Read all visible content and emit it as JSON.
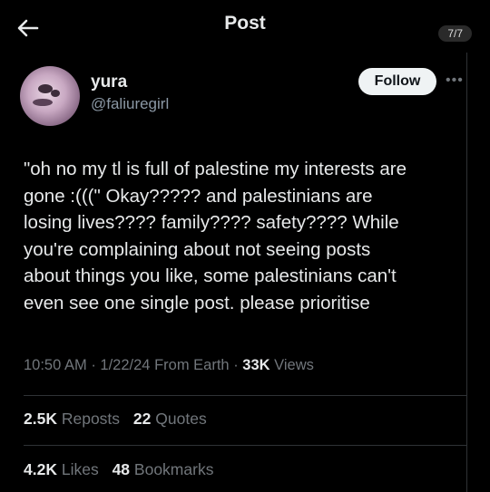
{
  "header": {
    "title": "Post",
    "pager": "7/7"
  },
  "author": {
    "name": "yura",
    "handle": "@faliuregirl",
    "follow_label": "Follow"
  },
  "tweet": {
    "lines": [
      "\"oh no my tl is full of palestine my interests are",
      "gone :(((\" Okay????? and palestinians are",
      "losing lives???? family???? safety???? While",
      "you're complaining about not seeing posts",
      "about things you like, some palestinians can't",
      "even see one single post. please prioritise"
    ]
  },
  "meta": {
    "time": "10:50 AM",
    "date": "1/22/24",
    "location": "From Earth",
    "views_count": "33K",
    "views_label": "Views"
  },
  "stats": {
    "reposts_count": "2.5K",
    "reposts_label": "Reposts",
    "quotes_count": "22",
    "quotes_label": "Quotes",
    "likes_count": "4.2K",
    "likes_label": "Likes",
    "bookmarks_count": "48",
    "bookmarks_label": "Bookmarks"
  },
  "icons": {
    "back": "arrow-left-icon",
    "more": "more-dots-icon"
  }
}
